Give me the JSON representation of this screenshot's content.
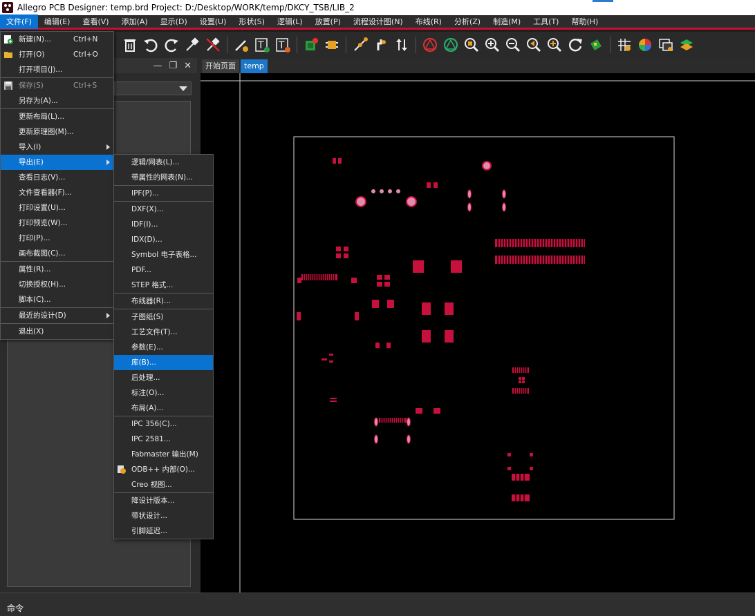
{
  "window": {
    "title": "Allegro PCB Designer: temp.brd  Project: D:/Desktop/WORK/temp/DKCY_TSB/LIB_2"
  },
  "menubar": [
    "文件(F)",
    "编辑(E)",
    "查看(V)",
    "添加(A)",
    "显示(D)",
    "设置(U)",
    "形状(S)",
    "逻辑(L)",
    "放置(P)",
    "流程设计图(N)",
    "布线(R)",
    "分析(Z)",
    "制造(M)",
    "工具(T)",
    "帮助(H)"
  ],
  "file_menu": {
    "new": {
      "label": "新建(N)...",
      "shortcut": "Ctrl+N"
    },
    "open": {
      "label": "打开(O)",
      "shortcut": "Ctrl+O"
    },
    "open_project": {
      "label": "打开项目(J)..."
    },
    "save": {
      "label": "保存(S)",
      "shortcut": "Ctrl+S"
    },
    "save_as": {
      "label": "另存为(A)..."
    },
    "update_layout": {
      "label": "更新布局(L)..."
    },
    "update_schematic": {
      "label": "更新原理图(M)..."
    },
    "import": {
      "label": "导入(I)"
    },
    "export": {
      "label": "导出(E)"
    },
    "view_log": {
      "label": "查看日志(V)..."
    },
    "file_viewer": {
      "label": "文件查看器(F)..."
    },
    "print_setup": {
      "label": "打印设置(U)..."
    },
    "print_preview": {
      "label": "打印预览(W)..."
    },
    "print": {
      "label": "打印(P)..."
    },
    "canvas_capture": {
      "label": "画布截图(C)..."
    },
    "properties": {
      "label": "属性(R)..."
    },
    "switch_license": {
      "label": "切换授权(H)..."
    },
    "script": {
      "label": "脚本(C)..."
    },
    "recent_designs": {
      "label": "最近的设计(D)"
    },
    "exit": {
      "label": "退出(X)"
    }
  },
  "export_menu": {
    "logic_netlist": "逻辑/网表(L)...",
    "netlist_with_props": "带属性的网表(N)...",
    "ipf": "IPF(P)...",
    "dxf": "DXF(X)...",
    "idf": "IDF(I)...",
    "idx": "IDX(D)...",
    "symbol_spreadsheet": "Symbol 电子表格...",
    "pdf": "PDF...",
    "step": "STEP 格式...",
    "router": "布线器(R)...",
    "subdrawing": "子图纸(S)",
    "techfile": "工艺文件(T)...",
    "parameters": "参数(E)...",
    "libraries": "库(B)...",
    "post_process": "后处理...",
    "annotation": "标注(O)...",
    "placement": "布局(A)...",
    "ipc356": "IPC 356(C)...",
    "ipc2581": "IPC 2581...",
    "fabmaster": "Fabmaster 输出(M)",
    "odb": "ODB++ 内部(O)...",
    "creo": "Creo 视图...",
    "downrev": "降设计版本...",
    "strip_design": "带状设计...",
    "pin_delay": "引脚延迟..."
  },
  "tabs": [
    "开始页面",
    "temp"
  ],
  "statusbar": {
    "command_label": "命令"
  },
  "colors": {
    "accent": "#0a73d2",
    "pad": "#c8103c",
    "via": "#e08ab0",
    "menu_bg": "#2b2b2b"
  }
}
